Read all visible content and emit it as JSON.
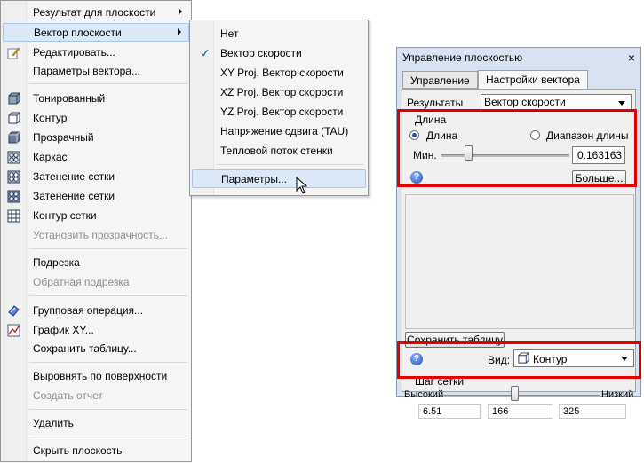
{
  "context_menu": {
    "items": [
      {
        "label": "Результат для плоскости"
      },
      {
        "label": "Вектор плоскости"
      },
      {
        "label": "Редактировать..."
      },
      {
        "label": "Параметры вектора..."
      },
      {
        "label": "Тонированный"
      },
      {
        "label": "Контур"
      },
      {
        "label": "Прозрачный"
      },
      {
        "label": "Каркас"
      },
      {
        "label": "Затенение сетки"
      },
      {
        "label": "Затенение сетки"
      },
      {
        "label": "Контур сетки"
      },
      {
        "label": "Установить прозрачность..."
      },
      {
        "label": "Подрезка"
      },
      {
        "label": "Обратная подрезка"
      },
      {
        "label": "Групповая операция..."
      },
      {
        "label": "График XY..."
      },
      {
        "label": "Сохранить таблицу..."
      },
      {
        "label": "Выровнять по поверхности"
      },
      {
        "label": "Создать отчет"
      },
      {
        "label": "Удалить"
      },
      {
        "label": "Скрыть плоскость"
      }
    ]
  },
  "submenu": {
    "items": [
      {
        "label": "Нет"
      },
      {
        "label": "Вектор скорости"
      },
      {
        "label": "XY Proj. Вектор скорости"
      },
      {
        "label": "XZ Proj. Вектор скорости"
      },
      {
        "label": "YZ Proj. Вектор скорости"
      },
      {
        "label": "Напряжение сдвига (TAU)"
      },
      {
        "label": "Тепловой поток стенки"
      },
      {
        "label": "Параметры..."
      }
    ],
    "checked_mark": "✓"
  },
  "panel": {
    "title": "Управление плоскостью",
    "close": "×",
    "tabs": [
      {
        "label": "Управление"
      },
      {
        "label": "Настройки вектора"
      }
    ],
    "results_label": "Результаты",
    "results_value": "Вектор скорости",
    "length_group": "Длина",
    "radio_length": "Длина",
    "radio_range": "Диапазон длины",
    "min_label": "Мин.",
    "min_value": "0.163163",
    "help": "?",
    "more_button": "Больше...",
    "save_table_button": "Сохранить таблицу",
    "view_label": "Вид:",
    "view_value": "Контур",
    "grid_step_group": "Шаг сетки",
    "high_label": "Высокий",
    "low_label": "Низкий",
    "grid_values": [
      "6.51",
      "166",
      "325"
    ]
  },
  "colors": {
    "highlight": "#dbe8f7",
    "annotation": "#e00000",
    "panel_frame": "#d7e3f1"
  }
}
